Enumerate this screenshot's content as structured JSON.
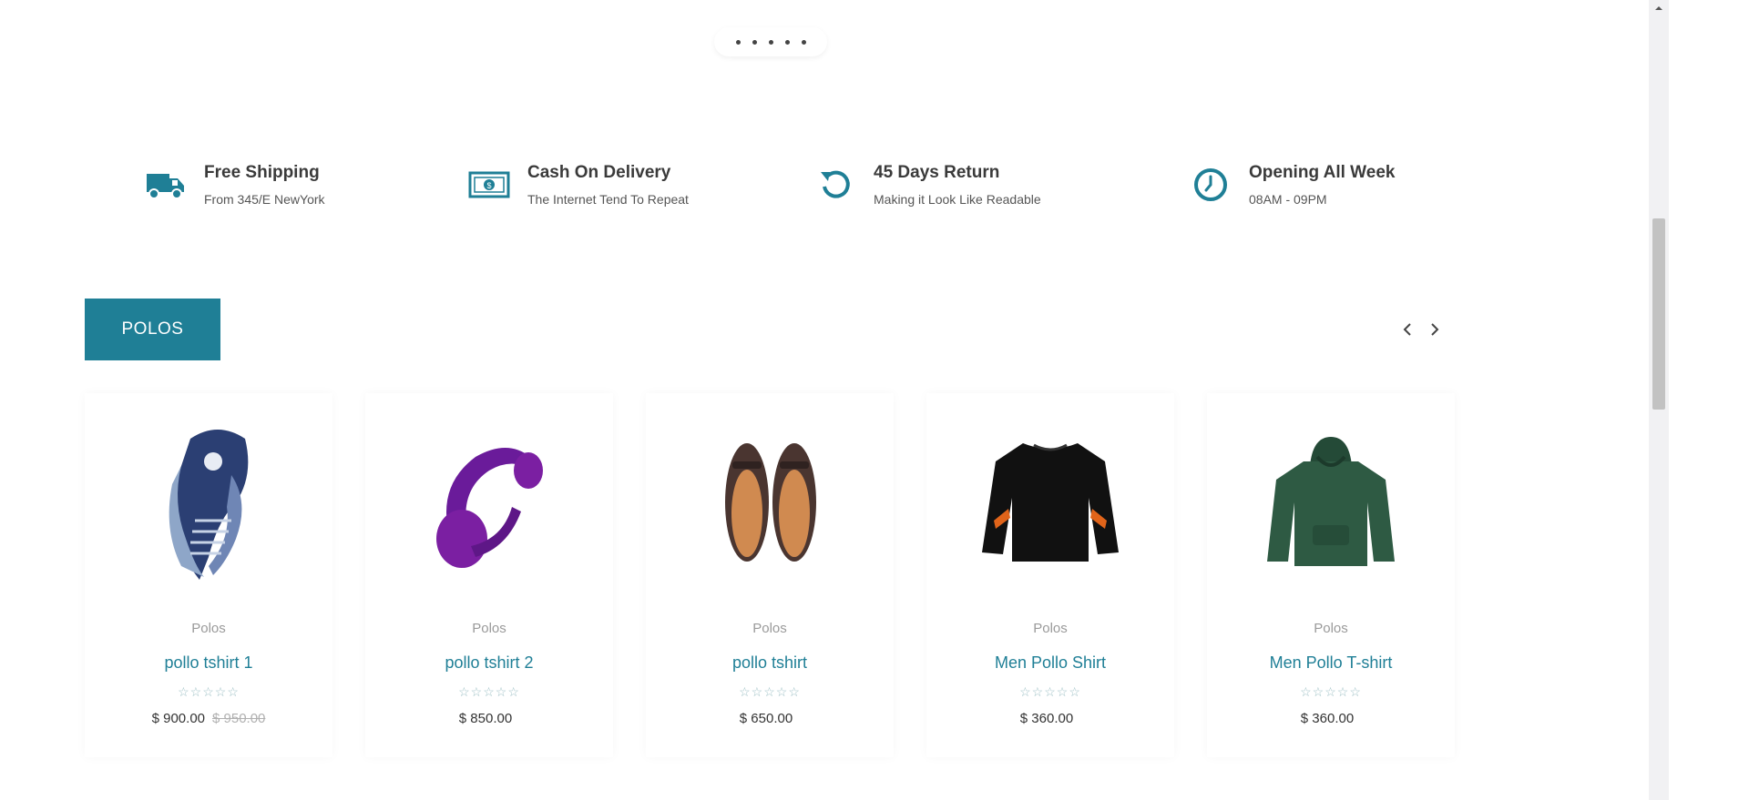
{
  "slider": {
    "dots": [
      1,
      2,
      3,
      4,
      5
    ]
  },
  "features": [
    {
      "icon": "truck-icon",
      "title": "Free Shipping",
      "subtitle": "From 345/E NewYork"
    },
    {
      "icon": "money-icon",
      "title": "Cash On Delivery",
      "subtitle": "The Internet Tend To Repeat"
    },
    {
      "icon": "return-icon",
      "title": "45 Days Return",
      "subtitle": "Making it Look Like Readable"
    },
    {
      "icon": "clock-icon",
      "title": "Opening All Week",
      "subtitle": "08AM - 09PM"
    }
  ],
  "section": {
    "tab_label": "POLOS"
  },
  "products": [
    {
      "category": "Polos",
      "name": "pollo tshirt 1",
      "rating": 0,
      "price": "$ 900.00",
      "old_price": "$ 950.00",
      "image": "scarf"
    },
    {
      "category": "Polos",
      "name": "pollo tshirt 2",
      "rating": 0,
      "price": "$ 850.00",
      "old_price": "",
      "image": "headphones"
    },
    {
      "category": "Polos",
      "name": "pollo tshirt",
      "rating": 0,
      "price": "$ 650.00",
      "old_price": "",
      "image": "loafers"
    },
    {
      "category": "Polos",
      "name": "Men Pollo Shirt",
      "rating": 0,
      "price": "$ 360.00",
      "old_price": "",
      "image": "black-sweater"
    },
    {
      "category": "Polos",
      "name": "Men Pollo T-shirt",
      "rating": 0,
      "price": "$ 360.00",
      "old_price": "",
      "image": "green-hoodie"
    }
  ],
  "colors": {
    "accent": "#1f7f96",
    "star_empty": "#9fc1c6"
  }
}
